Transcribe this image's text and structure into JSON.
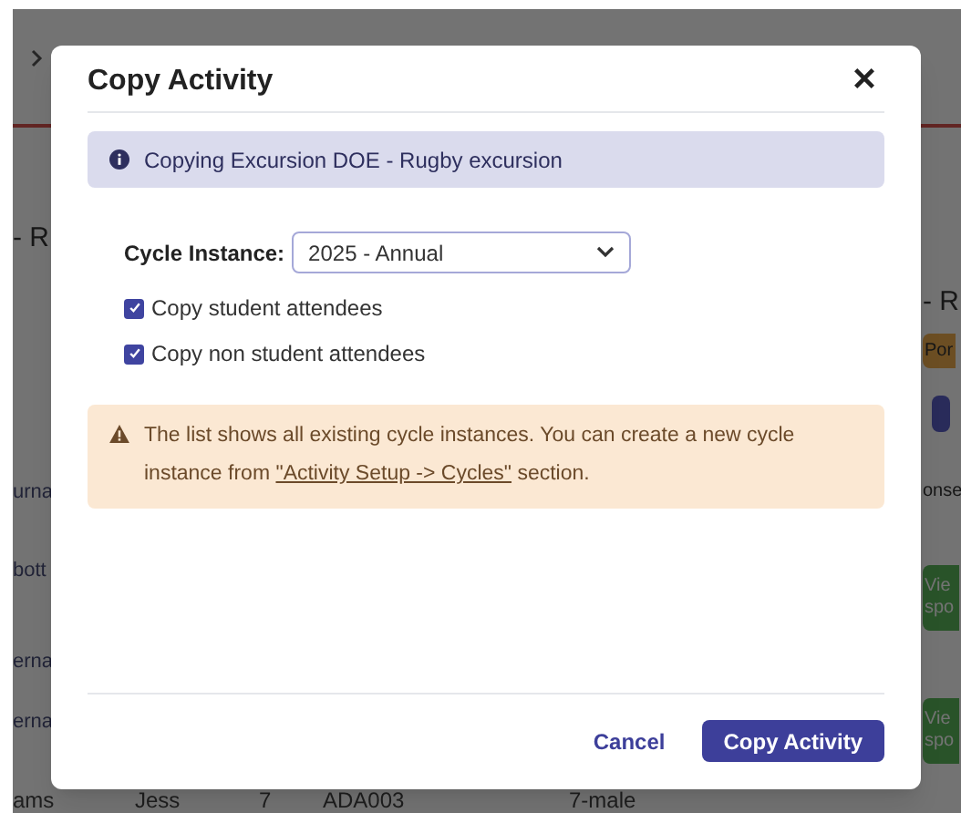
{
  "background": {
    "left_texts": [
      {
        "text": "- R",
        "kind": "heading"
      },
      {
        "text": "urna",
        "kind": "cell"
      },
      {
        "text": "bott",
        "kind": "cell"
      },
      {
        "text": "erna",
        "kind": "cell"
      },
      {
        "text": "erna",
        "kind": "cell"
      }
    ],
    "right_texts": [
      {
        "text": "- R",
        "kind": "heading"
      },
      {
        "text": "Por",
        "kind": "badge"
      },
      {
        "text": "onse",
        "kind": "cell"
      },
      {
        "text": "Vie spo",
        "kind": "button"
      },
      {
        "text": "Vie spo",
        "kind": "button"
      }
    ],
    "bottom_row": [
      "ams",
      "Jess",
      "7",
      "ADA003",
      "7-male"
    ]
  },
  "dialog": {
    "title": "Copy Activity",
    "info": "Copying Excursion DOE - Rugby excursion",
    "cycle_instance": {
      "label": "Cycle Instance:",
      "value": "2025 - Annual"
    },
    "options": [
      {
        "label": "Copy student attendees",
        "checked": true
      },
      {
        "label": "Copy non student attendees",
        "checked": true
      }
    ],
    "warning": {
      "text": "The list shows all existing cycle instances. You can create a new cycle instance from ",
      "link": "\"Activity Setup -> Cycles\"",
      "after": " section."
    },
    "buttons": [
      {
        "label": "Cancel",
        "kind": "secondary"
      },
      {
        "label": "Copy Activity",
        "kind": "primary"
      }
    ]
  }
}
